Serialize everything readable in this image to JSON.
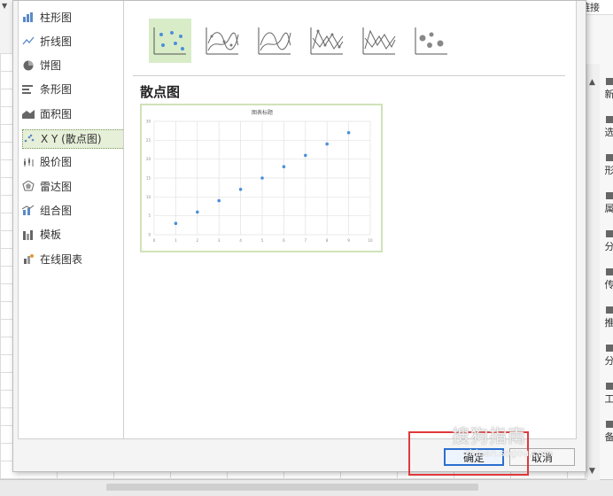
{
  "categories": [
    {
      "label": "柱形图",
      "icon": "bar-chart-icon"
    },
    {
      "label": "折线图",
      "icon": "line-chart-icon"
    },
    {
      "label": "饼图",
      "icon": "pie-chart-icon"
    },
    {
      "label": "条形图",
      "icon": "horizontal-bar-icon"
    },
    {
      "label": "面积图",
      "icon": "area-chart-icon"
    },
    {
      "label": "X Y (散点图)",
      "icon": "scatter-chart-icon"
    },
    {
      "label": "股价图",
      "icon": "stock-chart-icon"
    },
    {
      "label": "雷达图",
      "icon": "radar-chart-icon"
    },
    {
      "label": "组合图",
      "icon": "combo-chart-icon"
    },
    {
      "label": "模板",
      "icon": "template-icon"
    },
    {
      "label": "在线图表",
      "icon": "online-chart-icon"
    }
  ],
  "selected_category": "X Y (散点图)",
  "subtypes": [
    "scatter-markers-icon",
    "scatter-smooth-lines-markers-icon",
    "scatter-smooth-lines-icon",
    "scatter-straight-lines-markers-icon",
    "scatter-straight-lines-icon",
    "bubble-chart-icon"
  ],
  "section_title": "散点图",
  "buttons": {
    "ok": "确定",
    "cancel": "取消"
  },
  "right_panel": {
    "top_text": "链接",
    "items": [
      "新",
      "选",
      "形",
      "属",
      "分",
      "传",
      "推",
      "分",
      "工",
      "备"
    ]
  },
  "watermark": {
    "main": "搜狗指南",
    "sub": "zhinan.sogou.com"
  },
  "colors": {
    "accent": "#2a6fd0",
    "point": "#4a90d9",
    "highlight": "#e0393b",
    "selected_bg": "#d8ecc8"
  },
  "chart_data": {
    "type": "scatter",
    "title": "图表标题",
    "x": [
      1,
      2,
      3,
      4,
      5,
      6,
      7,
      8,
      9
    ],
    "y": [
      3,
      6,
      9,
      12,
      15,
      18,
      21,
      24,
      27
    ],
    "xlim": [
      0,
      10
    ],
    "ylim": [
      0,
      30
    ],
    "xticks": [
      "0",
      "1",
      "2",
      "3",
      "4",
      "5",
      "6",
      "7",
      "8",
      "9",
      "10"
    ],
    "yticks": [
      "0",
      "5",
      "10",
      "15",
      "20",
      "25",
      "30"
    ],
    "grid": true
  }
}
